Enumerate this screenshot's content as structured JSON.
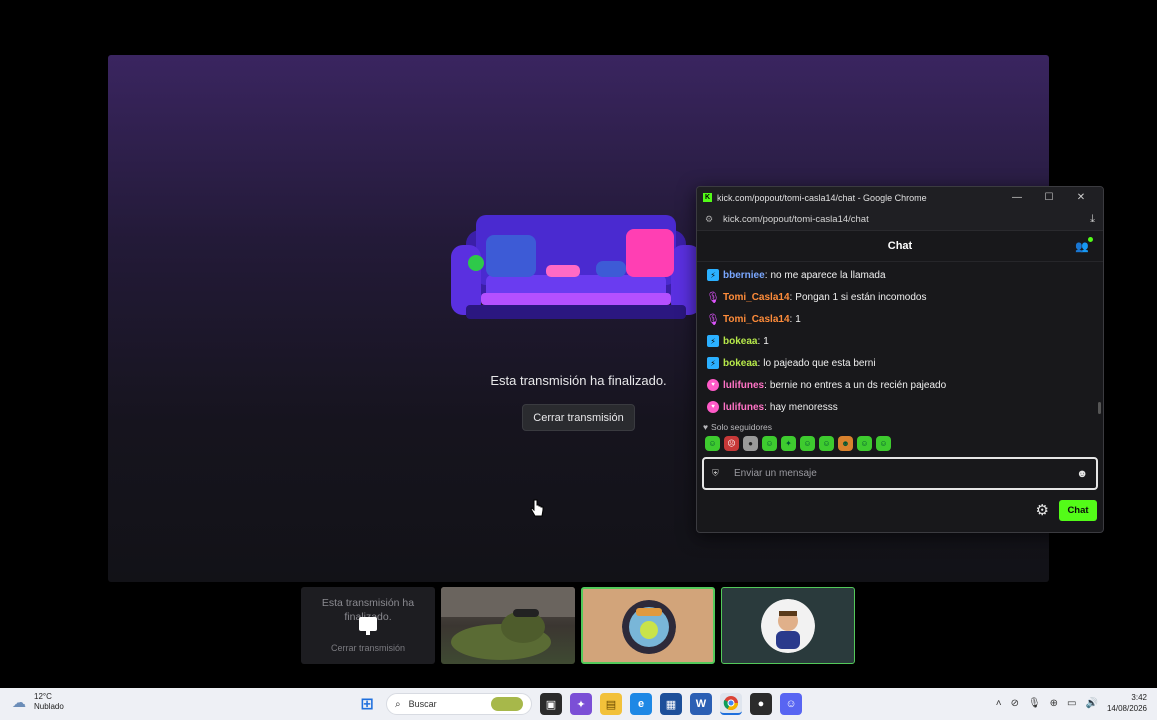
{
  "stage": {
    "ended_text": "Esta transmisión ha finalizado.",
    "close_label": "Cerrar transmisión"
  },
  "popup": {
    "window_title": "kick.com/popout/tomi-casla14/chat - Google Chrome",
    "url": "kick.com/popout/tomi-casla14/chat",
    "chat_title": "Chat",
    "messages": [
      {
        "badge": "bolt",
        "user": "bberniee",
        "color": "#7aa7ff",
        "text": "no me aparece la llamada"
      },
      {
        "badge": "mic",
        "user": "Tomi_Casla14",
        "color": "#ff8c3a",
        "text": "Pongan 1 si están incomodos"
      },
      {
        "badge": "mic",
        "user": "Tomi_Casla14",
        "color": "#ff8c3a",
        "text": "1"
      },
      {
        "badge": "bolt",
        "user": "bokeaa",
        "color": "#b7e94a",
        "text": "1"
      },
      {
        "badge": "bolt",
        "user": "bokeaa",
        "color": "#b7e94a",
        "text": "lo pajeado que esta berni"
      },
      {
        "badge": "heart",
        "user": "lulifunes",
        "color": "#ff73c6",
        "text": "bernie no entres a un ds recién pajeado"
      },
      {
        "badge": "heart",
        "user": "lulifunes",
        "color": "#ff73c6",
        "text": "hay menoresss"
      }
    ],
    "followers_only": "Solo seguidores",
    "input_placeholder": "Enviar un mensaje",
    "send_label": "Chat"
  },
  "thumbs": {
    "ended_text": "Esta transmisión ha finalizado.",
    "close_label": "Cerrar transmisión"
  },
  "taskbar": {
    "temperature": "12°C",
    "weather": "Nublado",
    "search_label": "Buscar",
    "time": "3:42",
    "date": "14/08/2026"
  },
  "colors": {
    "kick_green": "#53fc18",
    "chat_bg": "#18181b"
  }
}
